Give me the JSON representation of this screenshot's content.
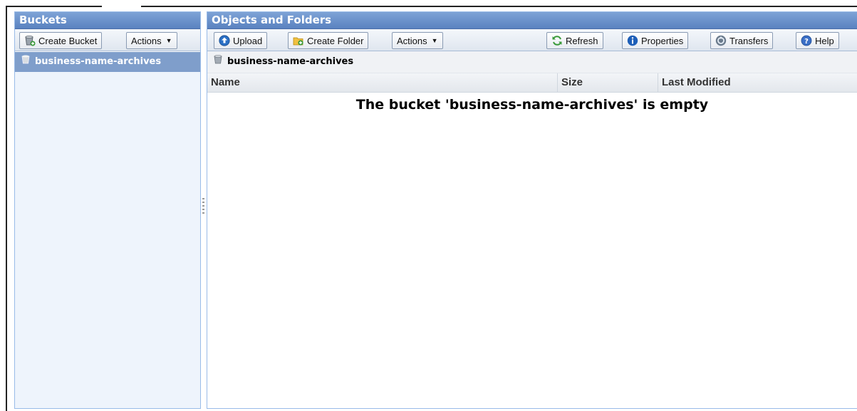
{
  "buckets_panel": {
    "title": "Buckets",
    "create_bucket_label": "Create Bucket",
    "actions_label": "Actions",
    "items": [
      {
        "name": "business-name-archives",
        "selected": true
      }
    ]
  },
  "objects_panel": {
    "title": "Objects and Folders",
    "toolbar": {
      "upload_label": "Upload",
      "create_folder_label": "Create Folder",
      "actions_label": "Actions",
      "refresh_label": "Refresh",
      "properties_label": "Properties",
      "transfers_label": "Transfers",
      "help_label": "Help"
    },
    "breadcrumb": "business-name-archives",
    "columns": [
      "Name",
      "Size",
      "Last Modified"
    ],
    "empty_message": "The bucket 'business-name-archives' is empty"
  },
  "icons": {
    "create_bucket": "bucket-add-icon",
    "upload": "upload-arrow-icon",
    "create_folder": "folder-add-icon",
    "refresh": "refresh-icon",
    "properties": "info-icon",
    "transfers": "transfers-icon",
    "help": "help-icon",
    "bucket": "bucket-icon"
  },
  "colors": {
    "header": "#5a82c0",
    "selected_row": "#7f9ecb",
    "left_body": "#eef4fc"
  }
}
